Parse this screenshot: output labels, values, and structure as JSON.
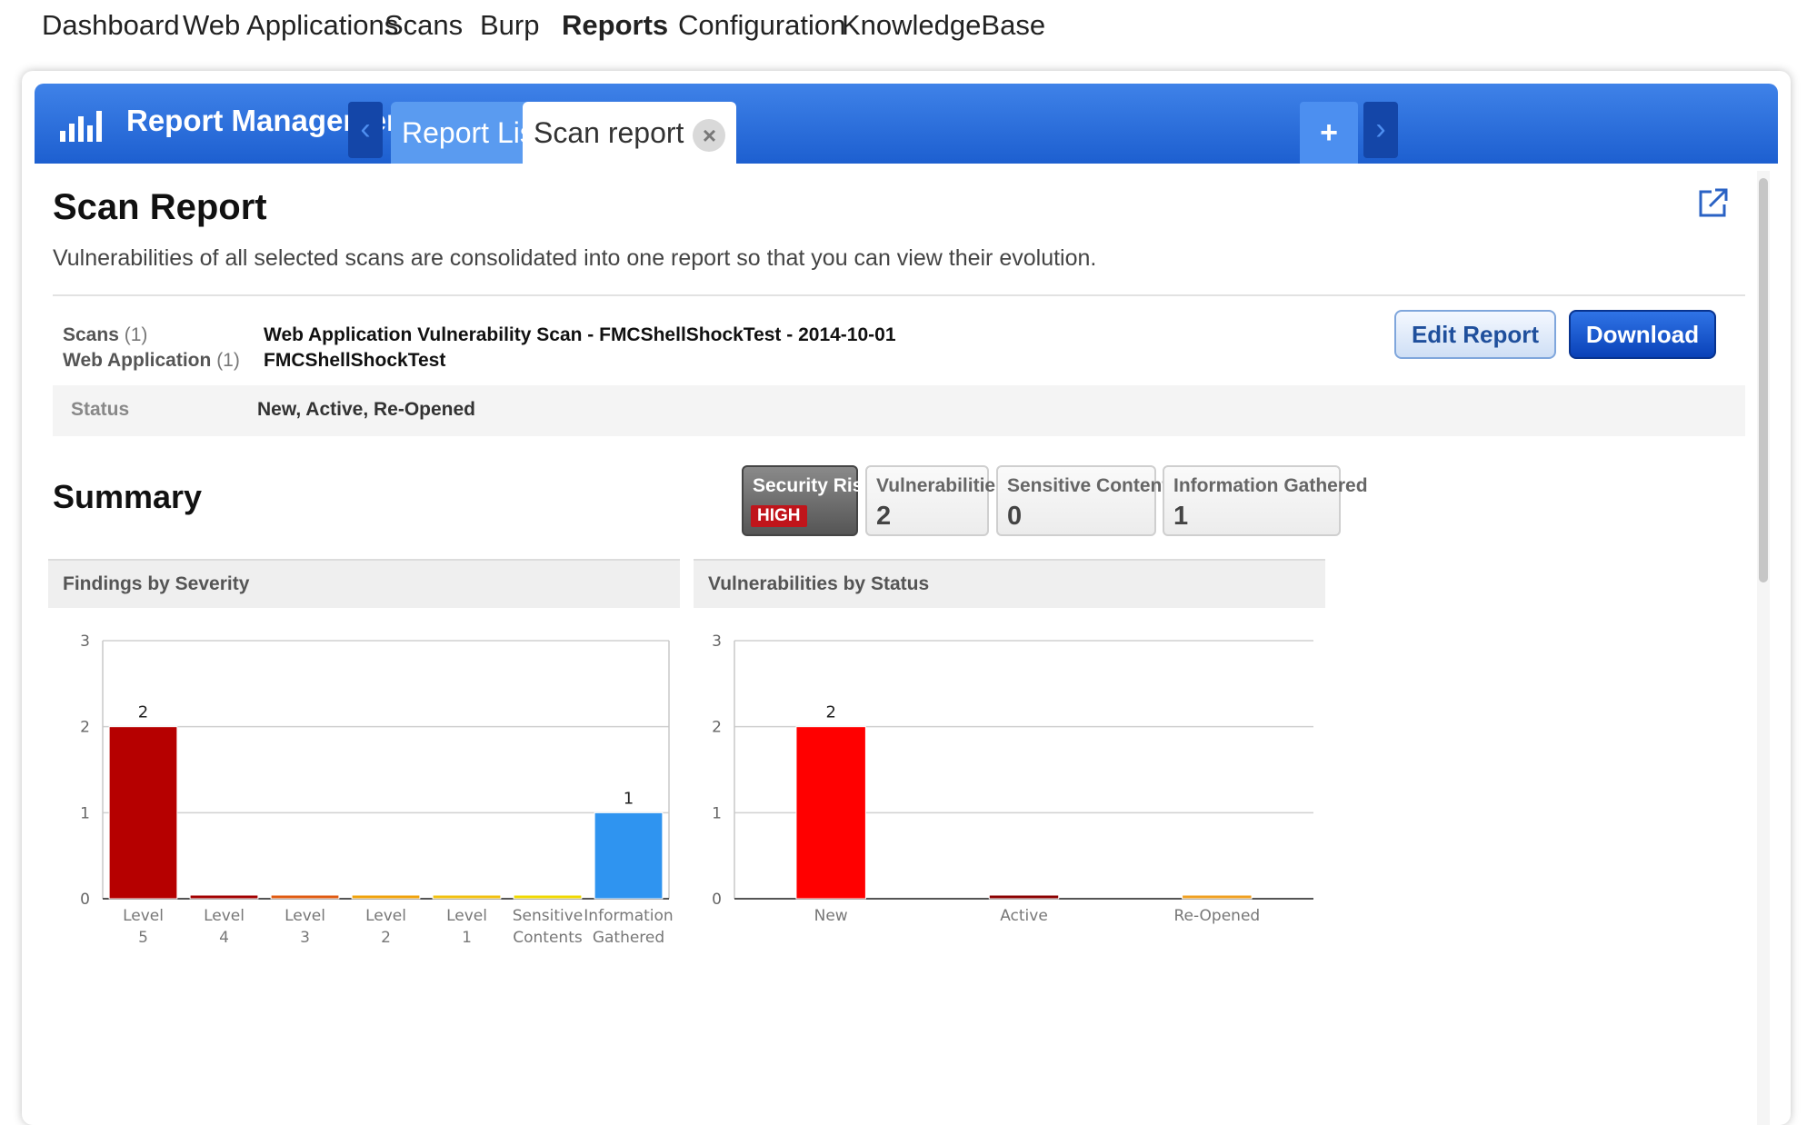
{
  "topnav": {
    "items": [
      "Dashboard",
      "Web Applications",
      "Scans",
      "Burp",
      "Reports",
      "Configuration",
      "KnowledgeBase"
    ],
    "active": "Reports"
  },
  "header": {
    "title": "Report Management",
    "tabs": [
      {
        "label": "Report List",
        "active": false
      },
      {
        "label": "Scan report",
        "active": true,
        "closable": true
      }
    ],
    "add_label": "+"
  },
  "page": {
    "title": "Scan Report",
    "description": "Vulnerabilities of all selected scans are consolidated into one report so that you can view their evolution."
  },
  "meta": {
    "scans_label": "Scans",
    "scans_count": "(1)",
    "scans_value": "Web Application Vulnerability Scan - FMCShellShockTest - 2014-10-01",
    "webapp_label": "Web Application",
    "webapp_count": "(1)",
    "webapp_value": "FMCShellShockTest",
    "status_label": "Status",
    "status_value": "New, Active, Re-Opened"
  },
  "buttons": {
    "edit": "Edit Report",
    "download": "Download"
  },
  "summary": {
    "title": "Summary",
    "security_risk_label": "Security Risk",
    "security_risk_value": "HIGH",
    "vulnerabilities_label": "Vulnerabilities",
    "vulnerabilities_value": "2",
    "sensitive_label": "Sensitive Contents",
    "sensitive_value": "0",
    "info_label": "Information Gathered",
    "info_value": "1"
  },
  "chart_data": [
    {
      "type": "bar",
      "title": "Findings by Severity",
      "categories": [
        [
          "Level",
          "5"
        ],
        [
          "Level",
          "4"
        ],
        [
          "Level",
          "3"
        ],
        [
          "Level",
          "2"
        ],
        [
          "Level",
          "1"
        ],
        [
          "Sensitive",
          "Contents"
        ],
        [
          "Information",
          "Gathered"
        ]
      ],
      "values": [
        2,
        0,
        0,
        0,
        0,
        0,
        1
      ],
      "data_labels": [
        "2",
        "",
        "",
        "",
        "",
        "",
        "1"
      ],
      "colors": [
        "#b60000",
        "#a30000",
        "#e05a10",
        "#f0a20a",
        "#f2c00f",
        "#f0d800",
        "#2f94f0"
      ],
      "ylim": [
        0,
        3
      ],
      "yticks": [
        0,
        1,
        2,
        3
      ],
      "grid": true
    },
    {
      "type": "bar",
      "title": "Vulnerabilities by Status",
      "categories": [
        [
          "New"
        ],
        [
          "Active"
        ],
        [
          "Re-Opened"
        ]
      ],
      "values": [
        2,
        0,
        0
      ],
      "data_labels": [
        "2",
        "",
        ""
      ],
      "colors": [
        "#ff0000",
        "#8b0000",
        "#f0a020"
      ],
      "ylim": [
        0,
        3
      ],
      "yticks": [
        0,
        1,
        2,
        3
      ],
      "grid": true
    }
  ]
}
